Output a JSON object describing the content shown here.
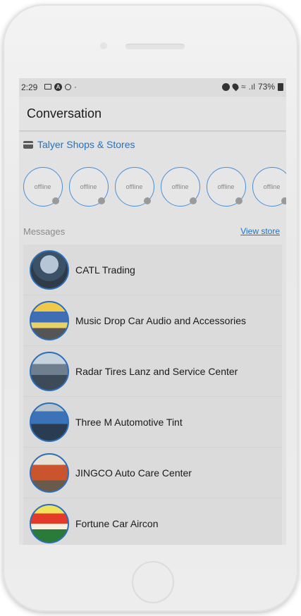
{
  "status_bar": {
    "time": "2:29",
    "battery": "73%",
    "left_icons": [
      "image-icon",
      "a-badge-icon",
      "ring-icon",
      "dot-icon"
    ],
    "right_icons": [
      "alarm-icon",
      "location-icon",
      "wifi-icon",
      "signal-icon",
      "battery-icon"
    ]
  },
  "app_bar": {
    "title": "Conversation"
  },
  "shop": {
    "title": "Talyer Shops & Stores",
    "icon": "store-icon"
  },
  "online_users": [
    {
      "status": "offline"
    },
    {
      "status": "offline"
    },
    {
      "status": "offline"
    },
    {
      "status": "offline"
    },
    {
      "status": "offline"
    },
    {
      "status": "offline"
    }
  ],
  "messages": {
    "label": "Messages",
    "view_store": "View store",
    "items": [
      {
        "name": "CATL Trading"
      },
      {
        "name": "Music Drop Car Audio and Accessories"
      },
      {
        "name": "Radar Tires Lanz and Service Center"
      },
      {
        "name": "Three M Automotive Tint"
      },
      {
        "name": "JINGCO Auto Care Center"
      },
      {
        "name": "Fortune Car Aircon"
      }
    ]
  },
  "colors": {
    "accent": "#1e73c8",
    "avatar_ring": "#2c6fb8"
  }
}
